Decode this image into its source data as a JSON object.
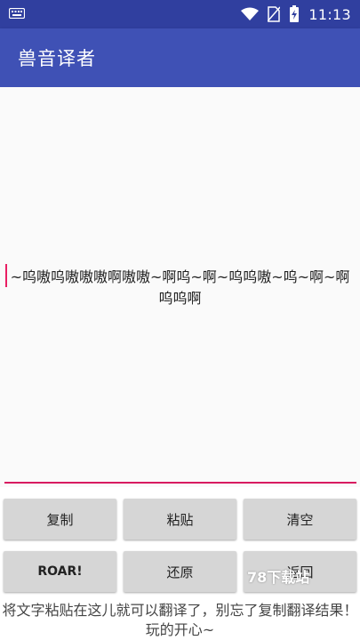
{
  "status_bar": {
    "time": "11:13",
    "icons": [
      "keyboard-icon",
      "wifi-icon",
      "no-sim-icon",
      "battery-charging-icon"
    ]
  },
  "app_bar": {
    "title": "兽音译者"
  },
  "output": {
    "text": "~呜嗷呜嗷嗷嗷啊嗷嗷~啊呜~啊~呜呜嗷~呜~啊~啊呜呜啊"
  },
  "buttons": {
    "copy": "复制",
    "paste": "粘贴",
    "clear": "清空",
    "roar": "ROAR!",
    "restore": "还原",
    "back": "返回"
  },
  "hint": "将文字粘贴在这儿就可以翻译了，别忘了复制翻译结果！玩的开心~",
  "watermark": "78下载站",
  "colors": {
    "primary": "#3f51b5",
    "primary_dark": "#303f9f",
    "accent": "#d81b60",
    "button_bg": "#d6d6d6"
  }
}
